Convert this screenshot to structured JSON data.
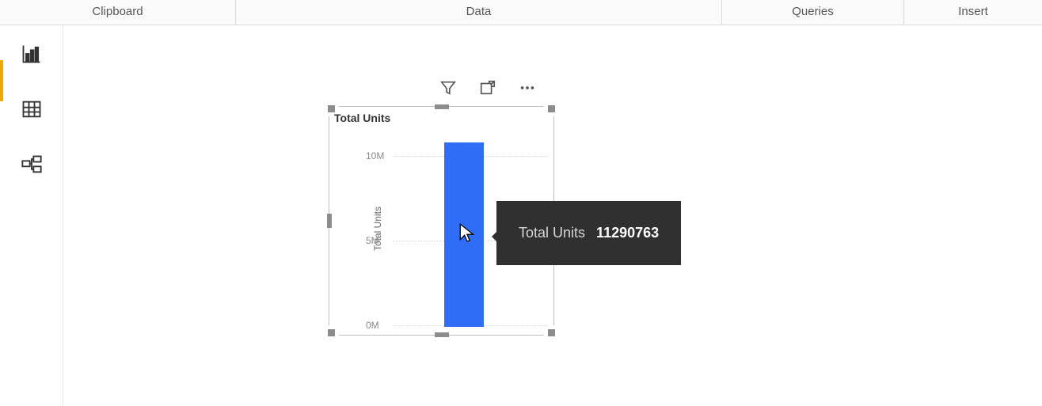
{
  "ribbon": {
    "tabs": [
      "Clipboard",
      "Data",
      "Queries",
      "Insert"
    ]
  },
  "left_rail": {
    "items": [
      "report-view",
      "data-view",
      "model-view"
    ]
  },
  "visual": {
    "title": "Total Units",
    "y_label": "Total Units",
    "ticks": {
      "t10": "10M",
      "t5": "5M",
      "t0": "0M"
    }
  },
  "tooltip": {
    "label": "Total Units",
    "value": "11290763"
  },
  "chart_data": {
    "type": "bar",
    "categories": [
      "Total Units"
    ],
    "values": [
      11290763
    ],
    "title": "Total Units",
    "xlabel": "",
    "ylabel": "Total Units",
    "ylim": [
      0,
      12000000
    ]
  }
}
